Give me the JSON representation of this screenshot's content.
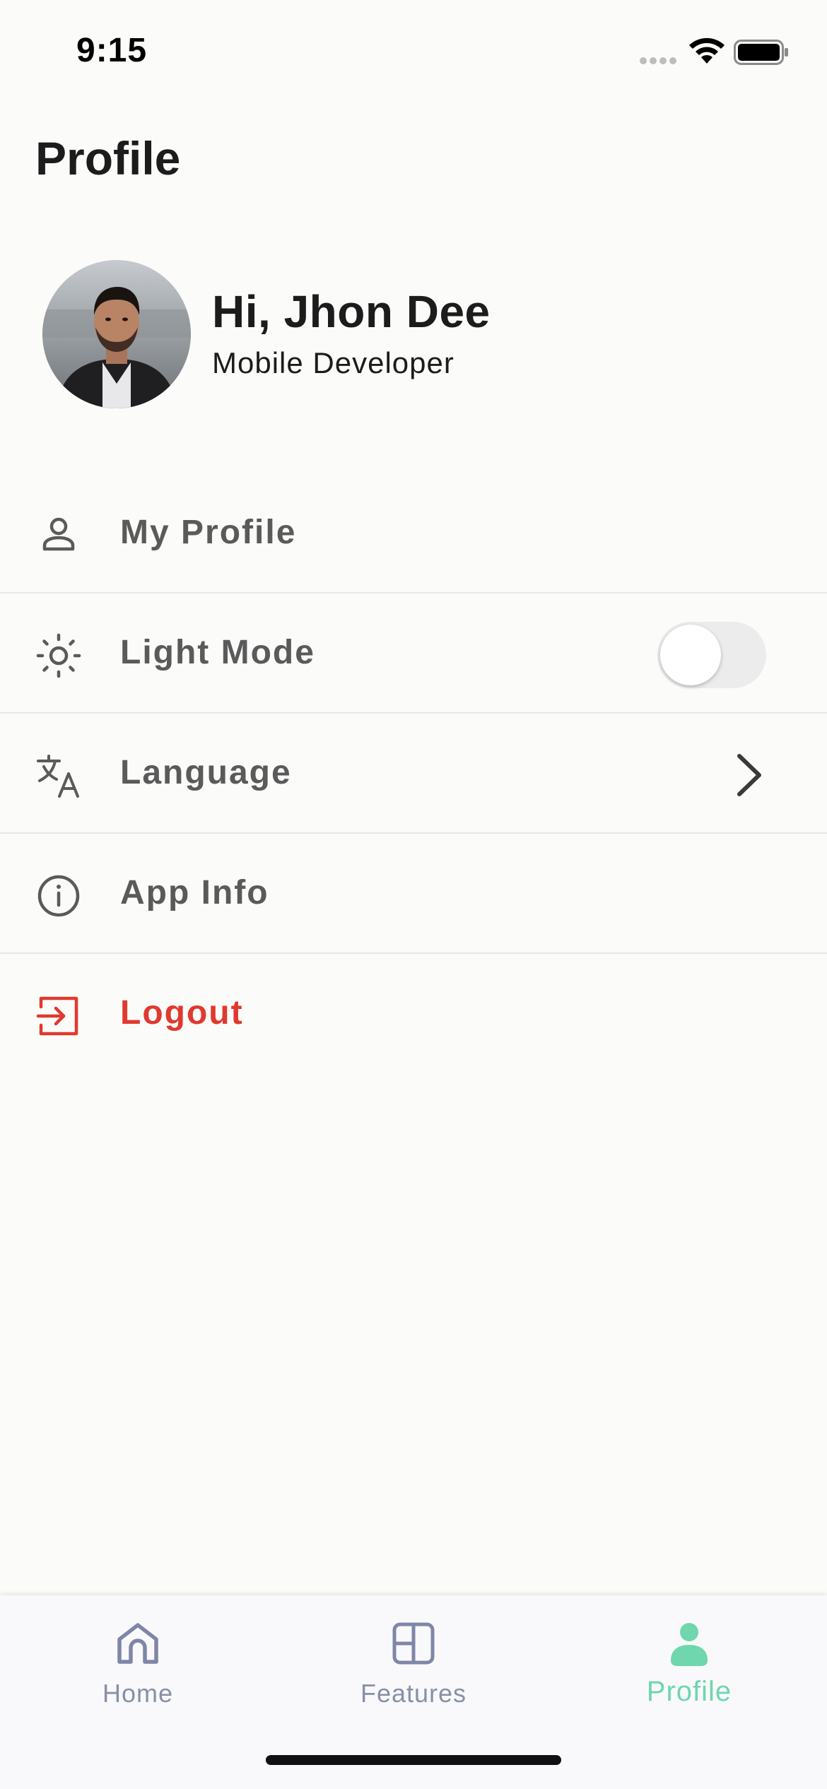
{
  "status_bar": {
    "time": "9:15"
  },
  "page": {
    "title": "Profile"
  },
  "profile": {
    "greeting": "Hi, Jhon Dee",
    "role": "Mobile Developer"
  },
  "menu": {
    "items": [
      {
        "label": "My Profile",
        "icon": "person-icon"
      },
      {
        "label": "Light Mode",
        "icon": "sun-icon",
        "control": "toggle",
        "toggle_on": false
      },
      {
        "label": "Language",
        "icon": "translate-icon",
        "control": "chevron"
      },
      {
        "label": "App Info",
        "icon": "info-icon"
      },
      {
        "label": "Logout",
        "icon": "logout-icon",
        "color": "#e0392f"
      }
    ]
  },
  "tab_bar": {
    "tabs": [
      {
        "label": "Home",
        "icon": "home-icon",
        "active": false
      },
      {
        "label": "Features",
        "icon": "grid-icon",
        "active": false
      },
      {
        "label": "Profile",
        "icon": "profile-icon",
        "active": true
      }
    ],
    "active_color": "#6fd6ad",
    "inactive_color": "#8a8fa8"
  }
}
